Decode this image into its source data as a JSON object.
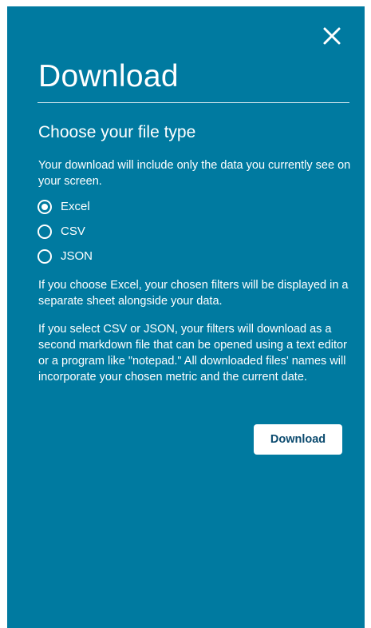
{
  "dialog": {
    "title": "Download",
    "close_icon": "close-icon",
    "subtitle": "Choose your file type",
    "intro": "Your download will include only the data you currently see on your screen.",
    "options": [
      {
        "label": "Excel",
        "selected": true
      },
      {
        "label": "CSV",
        "selected": false
      },
      {
        "label": "JSON",
        "selected": false
      }
    ],
    "note_excel": "If you choose Excel, your chosen filters will be displayed in a separate sheet alongside your data.",
    "note_csv_json": "If you select CSV or JSON, your filters will download as a second markdown file that can be opened using a text editor or a program like \"notepad.\" All downloaded files' names will incorporate your chosen metric and the current date.",
    "download_label": "Download"
  },
  "colors": {
    "panel_background": "#007aa0",
    "text": "#ffffff",
    "button_background": "#ffffff",
    "button_text": "#0b4a6e"
  }
}
